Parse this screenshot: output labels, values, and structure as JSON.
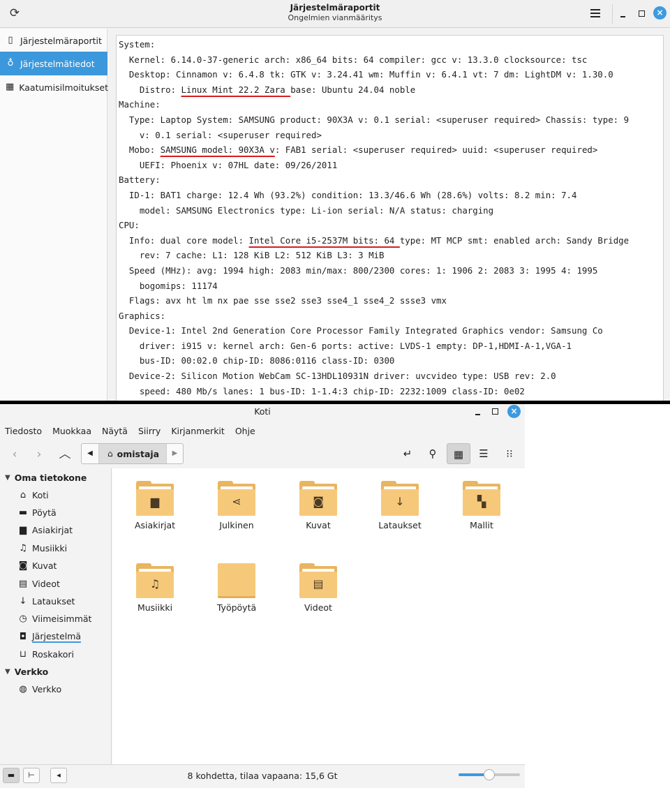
{
  "sysreport": {
    "title": "Järjestelmäraportit",
    "subtitle": "Ongelmien vianmääritys",
    "sidebar": [
      {
        "label": "Järjestelmäraportit",
        "icon": "clipboard-icon",
        "active": false
      },
      {
        "label": "Järjestelmätiedot",
        "icon": "lightbulb-icon",
        "active": true
      },
      {
        "label": "Kaatumisilmoitukset",
        "icon": "keyboard-icon",
        "active": false
      }
    ],
    "info_lines": [
      [
        {
          "t": "System:"
        }
      ],
      [
        {
          "t": "  Kernel: 6.14.0-37-generic arch: x86_64 bits: 64 compiler: gcc v: 13.3.0 clocksource: tsc"
        }
      ],
      [
        {
          "t": "  Desktop: Cinnamon v: 6.4.8 tk: GTK v: 3.24.41 wm: Muffin v: 6.4.1 vt: 7 dm: LightDM v: 1.30.0"
        }
      ],
      [
        {
          "t": "    Distro: "
        },
        {
          "t": "Linux Mint 22.2 Zara ",
          "u": true
        },
        {
          "t": "base: Ubuntu 24.04 noble"
        }
      ],
      [
        {
          "t": "Machine:"
        }
      ],
      [
        {
          "t": "  Type: Laptop System: SAMSUNG product: 90X3A v: 0.1 serial: <superuser required> Chassis: type: 9"
        }
      ],
      [
        {
          "t": "    v: 0.1 serial: <superuser required>"
        }
      ],
      [
        {
          "t": "  Mobo: "
        },
        {
          "t": "SAMSUNG model: 90X3A v",
          "u": true
        },
        {
          "t": ": FAB1 serial: <superuser required> uuid: <superuser required>"
        }
      ],
      [
        {
          "t": "    UEFI: Phoenix v: 07HL date: 09/26/2011"
        }
      ],
      [
        {
          "t": "Battery:"
        }
      ],
      [
        {
          "t": "  ID-1: BAT1 charge: 12.4 Wh (93.2%) condition: 13.3/46.6 Wh (28.6%) volts: 8.2 min: 7.4"
        }
      ],
      [
        {
          "t": "    model: SAMSUNG Electronics type: Li-ion serial: N/A status: charging"
        }
      ],
      [
        {
          "t": "CPU:"
        }
      ],
      [
        {
          "t": "  Info: dual core model: "
        },
        {
          "t": "Intel Core i5-2537M bits: 64 ",
          "u": true
        },
        {
          "t": "type: MT MCP smt: enabled arch: Sandy Bridge"
        }
      ],
      [
        {
          "t": "    rev: 7 cache: L1: 128 KiB L2: 512 KiB L3: 3 MiB"
        }
      ],
      [
        {
          "t": "  Speed (MHz): avg: 1994 high: 2083 min/max: 800/2300 cores: 1: 1906 2: 2083 3: 1995 4: 1995"
        }
      ],
      [
        {
          "t": "    bogomips: 11174"
        }
      ],
      [
        {
          "t": "  Flags: avx ht lm nx pae sse sse2 sse3 sse4_1 sse4_2 ssse3 vmx"
        }
      ],
      [
        {
          "t": "Graphics:"
        }
      ],
      [
        {
          "t": "  Device-1: Intel 2nd Generation Core Processor Family Integrated Graphics vendor: Samsung Co"
        }
      ],
      [
        {
          "t": "    driver: i915 v: kernel arch: Gen-6 ports: active: LVDS-1 empty: DP-1,HDMI-A-1,VGA-1"
        }
      ],
      [
        {
          "t": "    bus-ID: 00:02.0 chip-ID: 8086:0116 class-ID: 0300"
        }
      ],
      [
        {
          "t": "  Device-2: Silicon Motion WebCam SC-13HDL10931N driver: uvcvideo type: USB rev: 2.0"
        }
      ],
      [
        {
          "t": "    speed: 480 Mb/s lanes: 1 bus-ID: 1-1.4:3 chip-ID: 2232:1009 class-ID: 0e02"
        }
      ]
    ]
  },
  "filemanager": {
    "title": "Koti",
    "menu": [
      "Tiedosto",
      "Muokkaa",
      "Näytä",
      "Siirry",
      "Kirjanmerkit",
      "Ohje"
    ],
    "breadcrumb": "omistaja",
    "sidebar_sections": [
      {
        "title": "Oma tietokone",
        "items": [
          {
            "label": "Koti",
            "icon": "home-icon",
            "glyph": "⌂"
          },
          {
            "label": "Pöytä",
            "icon": "desktop-icon",
            "glyph": "▬"
          },
          {
            "label": "Asiakirjat",
            "icon": "document-icon",
            "glyph": "▆"
          },
          {
            "label": "Musiikki",
            "icon": "music-icon",
            "glyph": "♫"
          },
          {
            "label": "Kuvat",
            "icon": "camera-icon",
            "glyph": "◙"
          },
          {
            "label": "Videot",
            "icon": "film-icon",
            "glyph": "▤"
          },
          {
            "label": "Lataukset",
            "icon": "download-icon",
            "glyph": "↓"
          },
          {
            "label": "Viimeisimmät",
            "icon": "clock-icon",
            "glyph": "◷"
          },
          {
            "label": "Järjestelmä",
            "icon": "drive-icon",
            "glyph": "◘",
            "current": true
          },
          {
            "label": "Roskakori",
            "icon": "trash-icon",
            "glyph": "⊔"
          }
        ]
      },
      {
        "title": "Verkko",
        "items": [
          {
            "label": "Verkko",
            "icon": "globe-icon",
            "glyph": "◍"
          }
        ]
      }
    ],
    "files": [
      {
        "name": "Asiakirjat",
        "icon": "folder-documents-icon",
        "glyph": "▆"
      },
      {
        "name": "Julkinen",
        "icon": "folder-share-icon",
        "glyph": "⋖"
      },
      {
        "name": "Kuvat",
        "icon": "folder-pictures-icon",
        "glyph": "◙"
      },
      {
        "name": "Lataukset",
        "icon": "folder-download-icon",
        "glyph": "↓"
      },
      {
        "name": "Mallit",
        "icon": "folder-templates-icon",
        "glyph": "▚"
      },
      {
        "name": "Musiikki",
        "icon": "folder-music-icon",
        "glyph": "♫"
      },
      {
        "name": "Työpöytä",
        "icon": "folder-desktop-icon",
        "glyph": ""
      },
      {
        "name": "Videot",
        "icon": "folder-videos-icon",
        "glyph": "▤"
      }
    ],
    "status": "8 kohdetta, tilaa vapaana: 15,6 Gt",
    "zoom_level": 0.5,
    "colors": {
      "accent": "#3d9ae0",
      "folder": "#f6c97a",
      "folder_back": "#e9b55f",
      "underline": "#d61d1d"
    }
  }
}
